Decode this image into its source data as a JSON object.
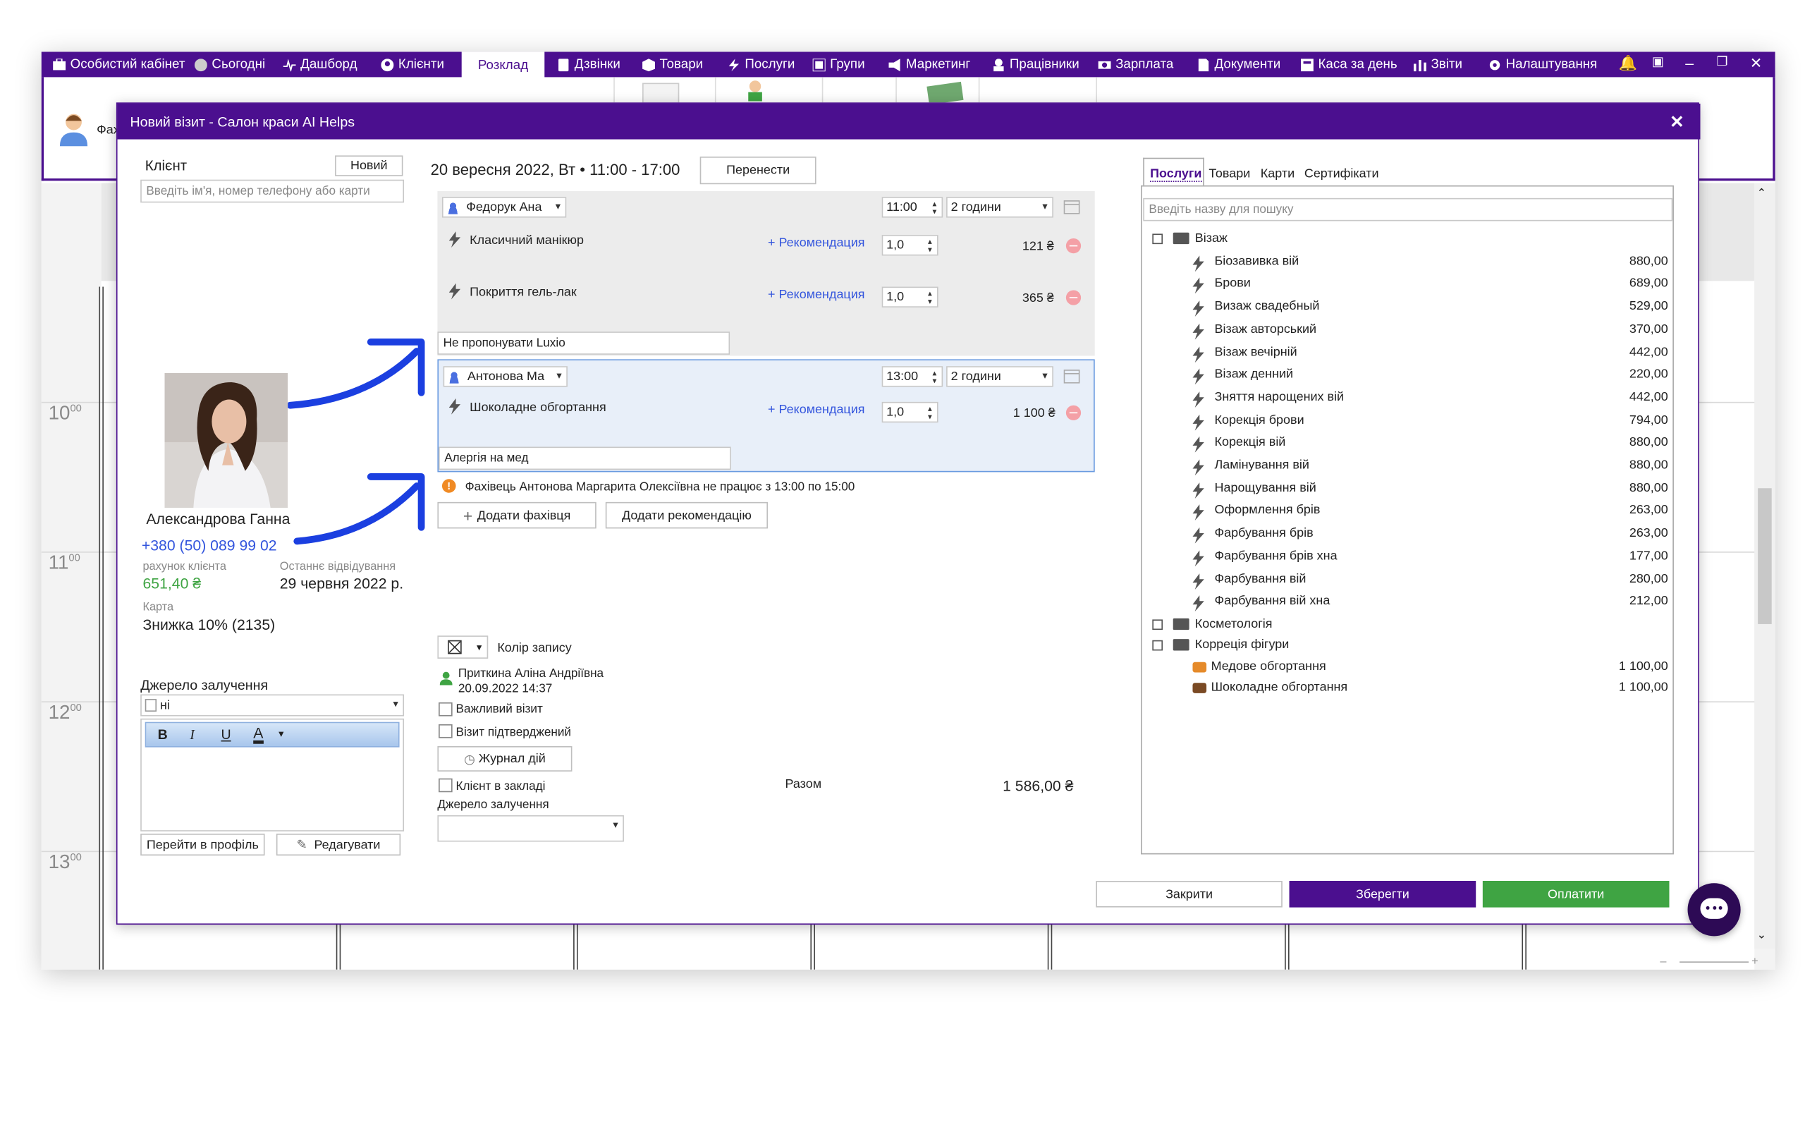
{
  "nav": [
    {
      "label": "Особистий кабінет",
      "icon": "cabinet-icon"
    },
    {
      "label": "Сьогодні",
      "icon": "clock-icon"
    },
    {
      "label": "Дашборд",
      "icon": "pulse-icon"
    },
    {
      "label": "Клієнти",
      "icon": "user-icon"
    },
    {
      "label": "Розклад",
      "icon": "calendar-icon"
    },
    {
      "label": "Дзвінки",
      "icon": "phone-icon"
    },
    {
      "label": "Товари",
      "icon": "box-icon"
    },
    {
      "label": "Послуги",
      "icon": "bolt-icon"
    },
    {
      "label": "Групи",
      "icon": "group-icon"
    },
    {
      "label": "Маркетинг",
      "icon": "megaphone-icon"
    },
    {
      "label": "Працівники",
      "icon": "worker-icon"
    },
    {
      "label": "Зарплата",
      "icon": "money-icon"
    },
    {
      "label": "Документи",
      "icon": "document-icon"
    },
    {
      "label": "Каса за день",
      "icon": "cash-register-icon"
    },
    {
      "label": "Звіти",
      "icon": "bar-chart-icon"
    },
    {
      "label": "Налаштування",
      "icon": "gear-icon"
    }
  ],
  "ribbon_partial_label": "Фах",
  "time_labels": [
    {
      "h": "10",
      "m": "00"
    },
    {
      "h": "11",
      "m": "00"
    },
    {
      "h": "12",
      "m": "00"
    },
    {
      "h": "13",
      "m": "00"
    }
  ],
  "dialog": {
    "title": "Новий візит - Салон краси AI Helps",
    "client": {
      "label": "Клієнт",
      "new_button": "Новий",
      "search_placeholder": "Введіть ім'я, номер телефону або карти",
      "name": "Александрова Ганна",
      "phone": "+380 (50) 089 99 02",
      "account_label": "рахунок клієнта",
      "account_value": "651,40 ₴",
      "last_visit_label": "Останнє відвідування",
      "last_visit_value": "29 червня 2022 р.",
      "card_label": "Карта",
      "card_value": "Знижка 10% (2135)",
      "source_label": "Джерело залучення",
      "source_value": "ні",
      "profile_button": "Перейти в профіль",
      "edit_button": "Редагувати"
    },
    "visit": {
      "datetime": "20 вересня 2022, Вт • 11:00 - 17:00",
      "move_button": "Перенести",
      "groups": [
        {
          "specialist": "Федорук Ана",
          "time": "11:00",
          "duration": "2 години",
          "services": [
            {
              "name": "Класичний манікюр",
              "rec": "+ Рекомендация",
              "qty": "1,0",
              "price": "121 ₴"
            },
            {
              "name": "Покриття гель-лак",
              "rec": "+ Рекомендация",
              "qty": "1,0",
              "price": "365 ₴"
            }
          ],
          "note": "Не пропонувати Luxio"
        },
        {
          "specialist": "Антонова Ма",
          "time": "13:00",
          "duration": "2 години",
          "services": [
            {
              "name": "Шоколадне обгортання",
              "rec": "+ Рекомендация",
              "qty": "1,0",
              "price": "1 100 ₴"
            }
          ],
          "note": "Алергія на мед"
        }
      ],
      "warning": "Фахівець Антонова Маргарита Олексіївна не працює з 13:00 по 15:00",
      "add_specialist_button": "Додати фахівця",
      "add_recommendation_button": "Додати рекомендацію",
      "color_label": "Колір запису",
      "creator_name": "Приткина Аліна Андріївна",
      "creator_date": "20.09.2022 14:37",
      "important_label": "Важливий візит",
      "confirmed_label": "Візит підтверджений",
      "journal_button": "Журнал дій",
      "in_salon_label": "Клієнт в закладі",
      "source_label": "Джерело залучення",
      "total_label": "Разом",
      "total_value": "1 586,00 ₴"
    },
    "catalog": {
      "tabs": [
        "Послуги",
        "Товари",
        "Карти",
        "Сертифікати"
      ],
      "search_placeholder": "Введіть назву для пошуку",
      "folders": [
        {
          "name": "Візаж",
          "items": [
            {
              "name": "Біозавивка вій",
              "price": "880,00"
            },
            {
              "name": "Брови",
              "price": "689,00"
            },
            {
              "name": "Визаж свадебный",
              "price": "529,00"
            },
            {
              "name": "Візаж авторський",
              "price": "370,00"
            },
            {
              "name": "Візаж вечірній",
              "price": "442,00"
            },
            {
              "name": "Візаж денний",
              "price": "220,00"
            },
            {
              "name": "Зняття нарощених вій",
              "price": "442,00"
            },
            {
              "name": "Корекція брови",
              "price": "794,00"
            },
            {
              "name": "Корекція вій",
              "price": "880,00"
            },
            {
              "name": "Ламінування вій",
              "price": "880,00"
            },
            {
              "name": "Нарощування вій",
              "price": "880,00"
            },
            {
              "name": "Оформлення брів",
              "price": "263,00"
            },
            {
              "name": "Фарбування брів",
              "price": "263,00"
            },
            {
              "name": "Фарбування брів хна",
              "price": "177,00"
            },
            {
              "name": "Фарбування вій",
              "price": "280,00"
            },
            {
              "name": "Фарбування вій хна",
              "price": "212,00"
            }
          ]
        },
        {
          "name": "Косметологія",
          "items": []
        },
        {
          "name": "Корреція фігури",
          "items": [
            {
              "name": "Медове обгортання",
              "price": "1 100,00"
            },
            {
              "name": "Шоколадне обгортання",
              "price": "1 100,00"
            }
          ]
        }
      ]
    },
    "buttons": {
      "close": "Закрити",
      "save": "Зберегти",
      "pay": "Оплатити"
    },
    "colors": {
      "purple": "#4b0f8f",
      "green": "#3fa443",
      "link": "#3355dd",
      "arrow": "#1b3fe0"
    }
  }
}
